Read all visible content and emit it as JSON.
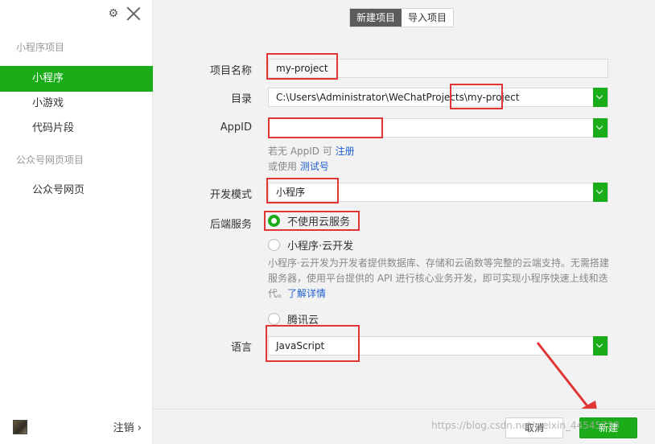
{
  "sidebar": {
    "groups": [
      {
        "title": "小程序项目",
        "items": [
          "小程序",
          "小游戏",
          "代码片段"
        ]
      },
      {
        "title": "公众号网页项目",
        "items": [
          "公众号网页"
        ]
      }
    ],
    "logout": "注销 ›",
    "icons": {
      "settings": "gear-icon",
      "close": "close-icon"
    }
  },
  "tabs": [
    "新建项目",
    "导入项目"
  ],
  "form": {
    "project_name": {
      "label": "项目名称",
      "value": "my-project"
    },
    "directory": {
      "label": "目录",
      "value": "C:\\Users\\Administrator\\WeChatProjects\\my-project"
    },
    "appid": {
      "label": "AppID",
      "value": "",
      "hint1_prefix": "若无 AppID 可 ",
      "hint1_link": "注册",
      "hint2_prefix": "或使用 ",
      "hint2_link": "测试号"
    },
    "dev_mode": {
      "label": "开发模式",
      "value": "小程序"
    },
    "backend": {
      "label": "后端服务",
      "options": [
        "不使用云服务",
        "小程序·云开发",
        "腾讯云"
      ],
      "selected": "不使用云服务",
      "description": "小程序·云开发为开发者提供数据库、存储和云函数等完整的云端支持。无需搭建服务器，使用平台提供的 API 进行核心业务开发，即可实现小程序快速上线和迭代。",
      "more_link": "了解详情"
    },
    "language": {
      "label": "语言",
      "value": "JavaScript"
    }
  },
  "footer": {
    "cancel": "取消",
    "create": "新建"
  },
  "watermark": "https://blog.csdn.net/weixin_44545723",
  "colors": {
    "accent": "#1aad19",
    "annotation": "#e03535",
    "link": "#1f5fcf"
  }
}
